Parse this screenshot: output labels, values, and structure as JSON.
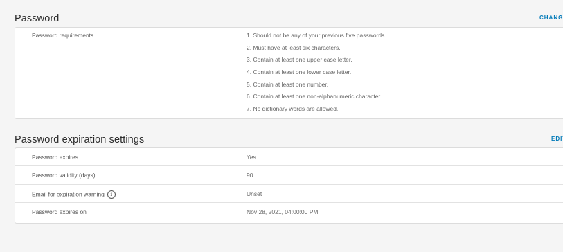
{
  "password_section": {
    "title": "Password",
    "action": "CHANGE",
    "requirements_label": "Password requirements",
    "requirements": [
      "1. Should not be any of your previous five passwords.",
      "2. Must have at least six characters.",
      "3. Contain at least one upper case letter.",
      "4. Contain at least one lower case letter.",
      "5. Contain at least one number.",
      "6. Contain at least one non-alphanumeric character.",
      "7. No dictionary words are allowed."
    ]
  },
  "expiration_section": {
    "title": "Password expiration settings",
    "action": "EDIT",
    "rows": [
      {
        "key": "Password expires",
        "value": "Yes"
      },
      {
        "key": "Password validity (days)",
        "value": "90"
      },
      {
        "key": "Email for expiration warning",
        "value": "Unset",
        "info_icon": "info-icon"
      },
      {
        "key": "Password expires on",
        "value": "Nov 28, 2021, 04:00:00 PM"
      }
    ]
  },
  "colors": {
    "link": "#0079b8",
    "background": "#f5f5f5",
    "card": "#ffffff"
  }
}
